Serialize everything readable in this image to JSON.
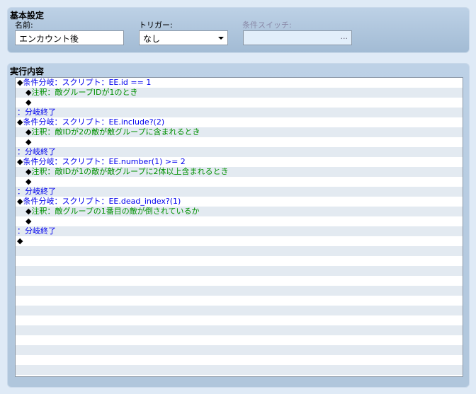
{
  "basic": {
    "title": "基本設定",
    "name_label": "名前:",
    "name_value": "エンカウント後",
    "trigger_label": "トリガー:",
    "trigger_value": "なし",
    "switch_label": "条件スイッチ:",
    "switch_button": "..."
  },
  "contents": {
    "title": "実行内容",
    "lines": [
      {
        "indent": 0,
        "mark": "◆",
        "text": "条件分岐：スクリプト：EE.id == 1",
        "color": "blue"
      },
      {
        "indent": 1,
        "mark": "◆",
        "text": "注釈：敵グループIDが1のとき",
        "color": "green"
      },
      {
        "indent": 1,
        "mark": "◆",
        "text": "",
        "color": "blk"
      },
      {
        "indent": 0,
        "mark": "",
        "text": "：分岐終了",
        "color": "blue"
      },
      {
        "indent": 0,
        "mark": "◆",
        "text": "条件分岐：スクリプト：EE.include?(2)",
        "color": "blue"
      },
      {
        "indent": 1,
        "mark": "◆",
        "text": "注釈：敵IDが2の敵が敵グループに含まれるとき",
        "color": "green"
      },
      {
        "indent": 1,
        "mark": "◆",
        "text": "",
        "color": "blk"
      },
      {
        "indent": 0,
        "mark": "",
        "text": "：分岐終了",
        "color": "blue"
      },
      {
        "indent": 0,
        "mark": "◆",
        "text": "条件分岐：スクリプト：EE.number(1) >= 2",
        "color": "blue"
      },
      {
        "indent": 1,
        "mark": "◆",
        "text": "注釈：敵IDが1の敵が敵グループに2体以上含まれるとき",
        "color": "green"
      },
      {
        "indent": 1,
        "mark": "◆",
        "text": "",
        "color": "blk"
      },
      {
        "indent": 0,
        "mark": "",
        "text": "：分岐終了",
        "color": "blue"
      },
      {
        "indent": 0,
        "mark": "◆",
        "text": "条件分岐：スクリプト：EE.dead_index?(1)",
        "color": "blue"
      },
      {
        "indent": 1,
        "mark": "◆",
        "text": "注釈：敵グループの1番目の敵が倒されているか",
        "color": "green"
      },
      {
        "indent": 1,
        "mark": "◆",
        "text": "",
        "color": "blk"
      },
      {
        "indent": 0,
        "mark": "",
        "text": "：分岐終了",
        "color": "blue"
      },
      {
        "indent": 0,
        "mark": "◆",
        "text": "",
        "color": "blk"
      }
    ]
  }
}
